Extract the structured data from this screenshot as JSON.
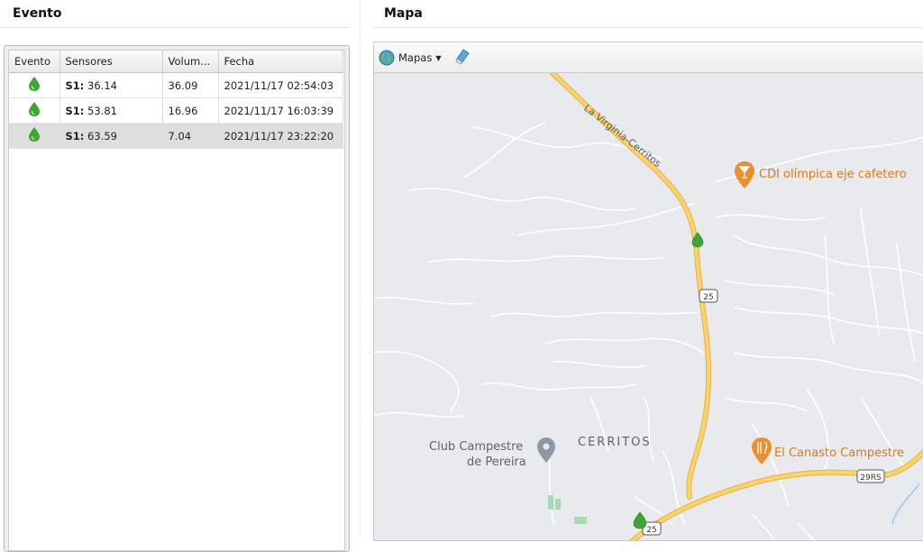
{
  "event_panel": {
    "title": "Evento",
    "columns": [
      "Evento",
      "Sensores",
      "Volum...",
      "Fecha"
    ],
    "rows": [
      {
        "sensor_label": "S1:",
        "sensor_value": "36.14",
        "volume": "36.09",
        "date": "2021/11/17 02:54:03"
      },
      {
        "sensor_label": "S1:",
        "sensor_value": "53.81",
        "volume": "16.96",
        "date": "2021/11/17 16:03:39"
      },
      {
        "sensor_label": "S1:",
        "sensor_value": "63.59",
        "volume": "7.04",
        "date": "2021/11/17 23:22:20"
      }
    ],
    "selected_row_index": 2
  },
  "map_panel": {
    "title": "Mapa",
    "toolbar": {
      "maps_label": "Mapas"
    },
    "labels": {
      "road_name": "La Virginia-Cerritos",
      "poi_1": "CDI olímpica eje cafetero",
      "poi_2": "El Canasto Campestre",
      "club_line1": "Club Campestre",
      "club_line2": "de Pereira",
      "town": "CERRITOS",
      "shield_25a": "25",
      "shield_25b": "25",
      "shield_29rs": "29RS"
    }
  },
  "colors": {
    "drop_icon": "#3fa535",
    "road_major": "#f6c760",
    "map_bg": "#e8eaed",
    "poi_orange": "#e8912d",
    "poi_text": "#d97a17",
    "selected_row": "#dedede"
  }
}
